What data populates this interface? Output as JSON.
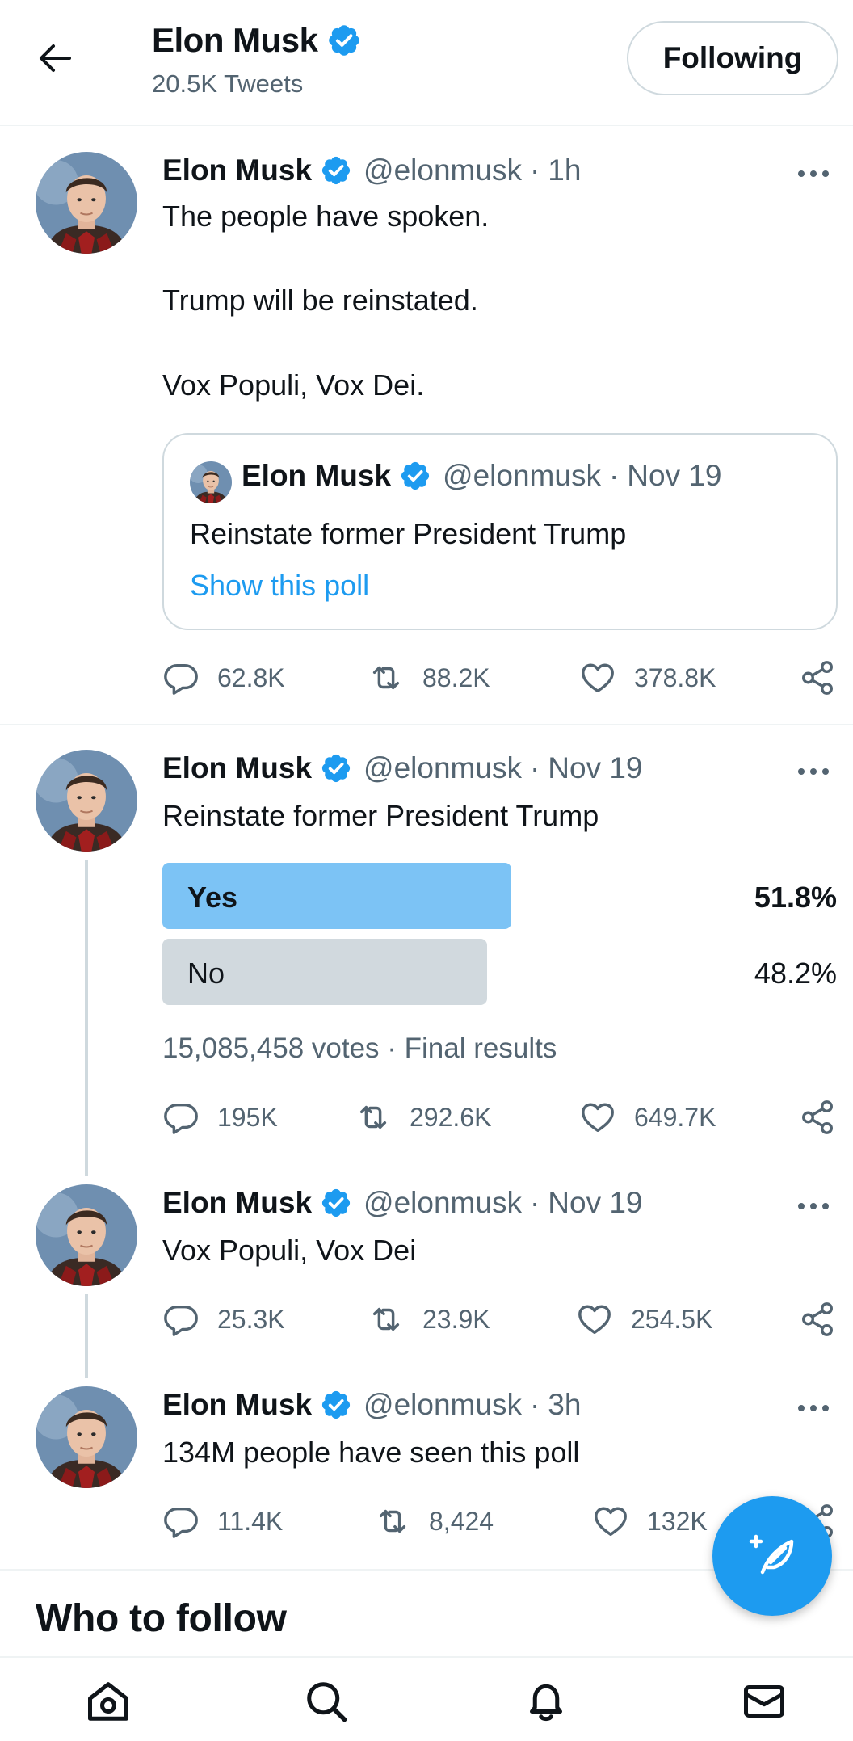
{
  "header": {
    "name": "Elon Musk",
    "tweet_count": "20.5K Tweets",
    "following_label": "Following"
  },
  "tweets": [
    {
      "name": "Elon Musk",
      "handle": "@elonmusk",
      "sep": "·",
      "time": "1h",
      "lines": [
        "The people have spoken.",
        "Trump will be reinstated.",
        "Vox Populi, Vox Dei."
      ],
      "quote": {
        "name": "Elon Musk",
        "handle": "@elonmusk",
        "sep": "·",
        "time": "Nov 19",
        "text": "Reinstate former President Trump",
        "link": "Show this poll"
      },
      "replies": "62.8K",
      "retweets": "88.2K",
      "likes": "378.8K"
    },
    {
      "name": "Elon Musk",
      "handle": "@elonmusk",
      "sep": "·",
      "time": "Nov 19",
      "text": "Reinstate former President Trump",
      "poll": {
        "options": [
          {
            "label": "Yes",
            "percent_text": "51.8%",
            "percent": 51.8,
            "winner": true
          },
          {
            "label": "No",
            "percent_text": "48.2%",
            "percent": 48.2,
            "winner": false
          }
        ],
        "meta": "15,085,458 votes · Final results"
      },
      "replies": "195K",
      "retweets": "292.6K",
      "likes": "649.7K"
    },
    {
      "name": "Elon Musk",
      "handle": "@elonmusk",
      "sep": "·",
      "time": "Nov 19",
      "text": "Vox Populi, Vox Dei",
      "replies": "25.3K",
      "retweets": "23.9K",
      "likes": "254.5K"
    },
    {
      "name": "Elon Musk",
      "handle": "@elonmusk",
      "sep": "·",
      "time": "3h",
      "text": "134M people have seen this poll",
      "replies": "11.4K",
      "retweets": "8,424",
      "likes": "132K"
    }
  ],
  "who_to_follow": "Who to follow",
  "icons": {
    "back": "arrow-left-icon",
    "verified": "verified-badge-icon",
    "more": "more-dots-icon",
    "reply": "reply-icon",
    "retweet": "retweet-icon",
    "like": "heart-icon",
    "share": "share-icon",
    "compose": "compose-tweet-icon",
    "home": "home-icon",
    "search": "search-icon",
    "notifications": "bell-icon",
    "messages": "mail-icon"
  },
  "colors": {
    "accent": "#1d9bf0",
    "poll_winner": "#7cc3f5",
    "poll_other": "#d1d9de",
    "secondary_text": "#536471"
  }
}
